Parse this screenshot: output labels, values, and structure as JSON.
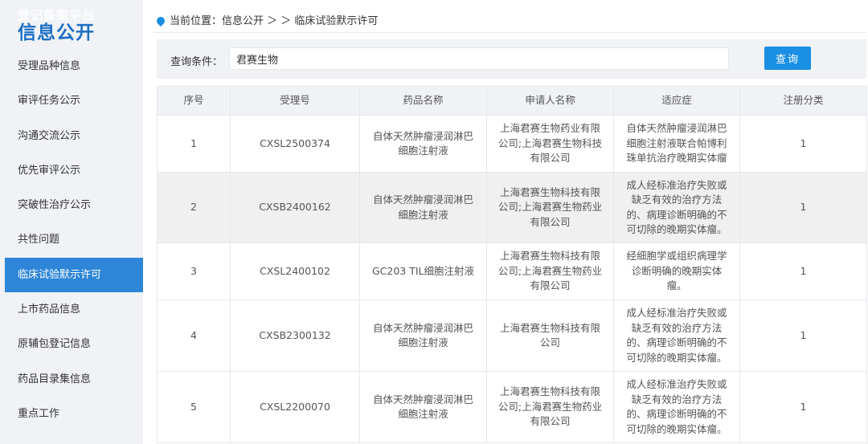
{
  "sidebar": {
    "ghost_title": "登记备案平台",
    "title": "信息公开",
    "items": [
      {
        "label": "受理品种信息",
        "active": false
      },
      {
        "label": "审评任务公示",
        "active": false
      },
      {
        "label": "沟通交流公示",
        "active": false
      },
      {
        "label": "优先审评公示",
        "active": false
      },
      {
        "label": "突破性治疗公示",
        "active": false
      },
      {
        "label": "共性问题",
        "active": false
      },
      {
        "label": "临床试验默示许可",
        "active": true
      },
      {
        "label": "上市药品信息",
        "active": false
      },
      {
        "label": "原辅包登记信息",
        "active": false
      },
      {
        "label": "药品目录集信息",
        "active": false
      },
      {
        "label": "重点工作",
        "active": false
      }
    ]
  },
  "breadcrumb": {
    "text": "当前位置：信息公开 ＞ ＞ 临床试验默示许可"
  },
  "search": {
    "label": "查询条件：",
    "value": "君赛生物",
    "button": "查询"
  },
  "table": {
    "headers": [
      "序号",
      "受理号",
      "药品名称",
      "申请人名称",
      "适应症",
      "注册分类"
    ],
    "rows": [
      {
        "no": "1",
        "accept": "CXSL2500374",
        "drug": "自体天然肿瘤浸润淋巴细胞注射液",
        "applicant": "上海君赛生物药业有限公司;上海君赛生物科技有限公司",
        "indication": "自体天然肿瘤浸润淋巴细胞注射液联合帕博利珠单抗治疗晚期实体瘤",
        "category": "1"
      },
      {
        "no": "2",
        "accept": "CXSB2400162",
        "drug": "自体天然肿瘤浸润淋巴细胞注射液",
        "applicant": "上海君赛生物科技有限公司;上海君赛生物药业有限公司",
        "indication": "成人经标准治疗失败或缺乏有效的治疗方法的、病理诊断明确的不可切除的晚期实体瘤。",
        "category": "1"
      },
      {
        "no": "3",
        "accept": "CXSL2400102",
        "drug": "GC203 TIL细胞注射液",
        "applicant": "上海君赛生物科技有限公司;上海君赛生物药业有限公司",
        "indication": "经细胞学或组织病理学诊断明确的晚期实体瘤。",
        "category": "1"
      },
      {
        "no": "4",
        "accept": "CXSB2300132",
        "drug": "自体天然肿瘤浸润淋巴细胞注射液",
        "applicant": "上海君赛生物科技有限公司",
        "indication": "成人经标准治疗失败或缺乏有效的治疗方法的、病理诊断明确的不可切除的晚期实体瘤。",
        "category": "1"
      },
      {
        "no": "5",
        "accept": "CXSL2200070",
        "drug": "自体天然肿瘤浸润淋巴细胞注射液",
        "applicant": "上海君赛生物科技有限公司;上海君赛生物药业有限公司",
        "indication": "成人经标准治疗失败或缺乏有效的治疗方法的、病理诊断明确的不可切除的晚期实体瘤。",
        "category": "1"
      }
    ]
  },
  "colors": {
    "accent": "#1a8fe3",
    "active_menu": "#2e86d8",
    "title": "#1e6fc4",
    "panel_bg": "#f0f2f5"
  }
}
